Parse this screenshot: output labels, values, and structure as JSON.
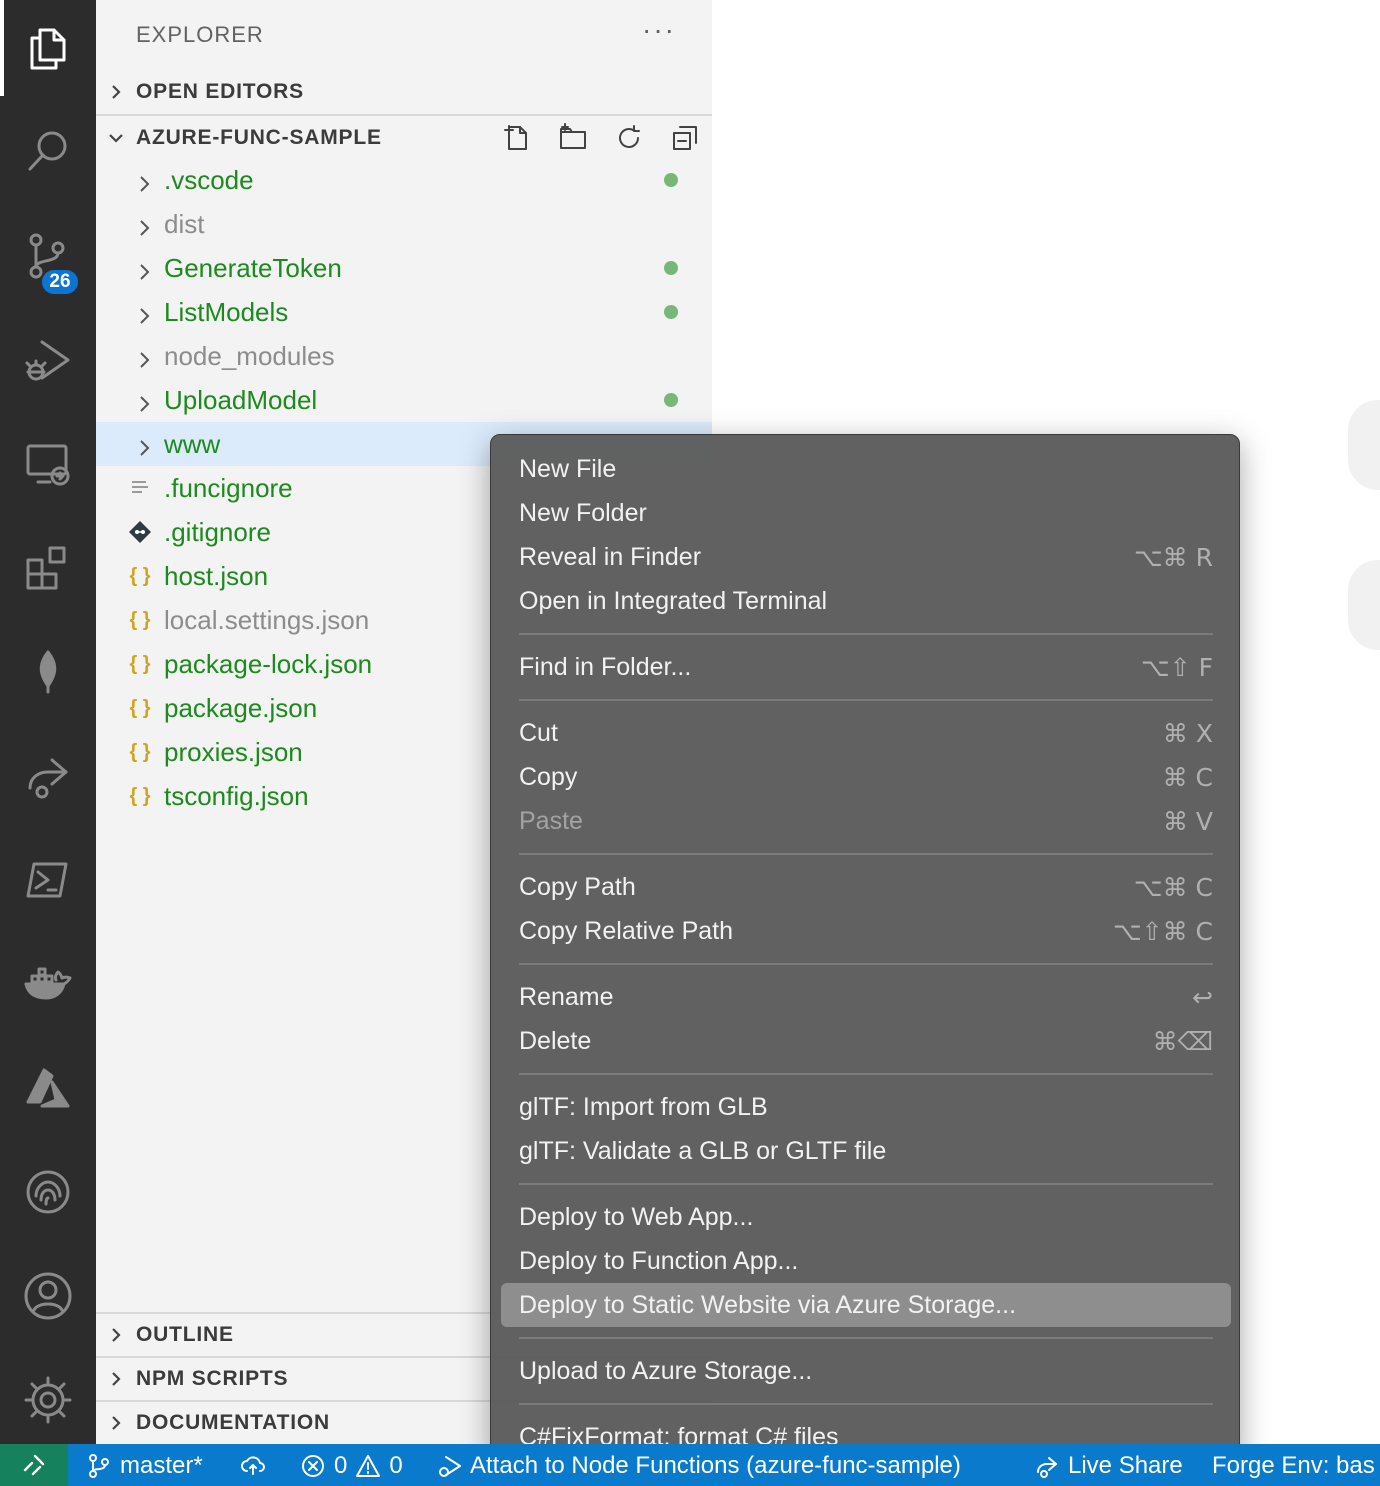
{
  "sidebar": {
    "title": "EXPLORER",
    "more": "···",
    "sections": {
      "open_editors": "OPEN EDITORS",
      "workspace": "AZURE-FUNC-SAMPLE",
      "outline": "OUTLINE",
      "npm_scripts": "NPM SCRIPTS",
      "documentation": "DOCUMENTATION"
    },
    "tree": [
      {
        "label": ".vscode",
        "type": "folder",
        "modified": true
      },
      {
        "label": "dist",
        "type": "folder",
        "modified": false
      },
      {
        "label": "GenerateToken",
        "type": "folder",
        "modified": true
      },
      {
        "label": "ListModels",
        "type": "folder",
        "modified": true
      },
      {
        "label": "node_modules",
        "type": "folder",
        "modified": false
      },
      {
        "label": "UploadModel",
        "type": "folder",
        "modified": true
      },
      {
        "label": "www",
        "type": "folder",
        "modified": false,
        "selected": true
      },
      {
        "label": ".funcignore",
        "type": "file-text"
      },
      {
        "label": ".gitignore",
        "type": "file-git"
      },
      {
        "label": "host.json",
        "type": "file-json"
      },
      {
        "label": "local.settings.json",
        "type": "file-json"
      },
      {
        "label": "package-lock.json",
        "type": "file-json"
      },
      {
        "label": "package.json",
        "type": "file-json"
      },
      {
        "label": "proxies.json",
        "type": "file-json"
      },
      {
        "label": "tsconfig.json",
        "type": "file-json"
      }
    ]
  },
  "activity_bar": {
    "source_control_badge": "26",
    "items": [
      "files-icon",
      "search-icon",
      "source-control-icon",
      "run-debug-icon",
      "remote-explorer-icon",
      "extensions-icon",
      "mongodb-icon",
      "live-share-icon",
      "powershell-icon",
      "docker-icon",
      "azure-icon",
      "fingerprint-icon",
      "account-icon",
      "settings-gear-icon"
    ]
  },
  "context_menu": {
    "items": [
      {
        "label": "New File",
        "shortcut": ""
      },
      {
        "label": "New Folder",
        "shortcut": ""
      },
      {
        "label": "Reveal in Finder",
        "shortcut": "⌥⌘ R"
      },
      {
        "label": "Open in Integrated Terminal",
        "shortcut": ""
      },
      {
        "sep": true
      },
      {
        "label": "Find in Folder...",
        "shortcut": "⌥⇧ F"
      },
      {
        "sep": true
      },
      {
        "label": "Cut",
        "shortcut": "⌘ X"
      },
      {
        "label": "Copy",
        "shortcut": "⌘ C"
      },
      {
        "label": "Paste",
        "shortcut": "⌘ V",
        "disabled": true
      },
      {
        "sep": true
      },
      {
        "label": "Copy Path",
        "shortcut": "⌥⌘ C"
      },
      {
        "label": "Copy Relative Path",
        "shortcut": "⌥⇧⌘ C"
      },
      {
        "sep": true
      },
      {
        "label": "Rename",
        "shortcut": "↩"
      },
      {
        "label": "Delete",
        "shortcut": "⌘⌫"
      },
      {
        "sep": true
      },
      {
        "label": "glTF: Import from GLB",
        "shortcut": ""
      },
      {
        "label": "glTF: Validate a GLB or GLTF file",
        "shortcut": ""
      },
      {
        "sep": true
      },
      {
        "label": "Deploy to Web App...",
        "shortcut": ""
      },
      {
        "label": "Deploy to Function App...",
        "shortcut": ""
      },
      {
        "label": "Deploy to Static Website via Azure Storage...",
        "shortcut": "",
        "highlighted": true
      },
      {
        "sep": true
      },
      {
        "label": "Upload to Azure Storage...",
        "shortcut": ""
      },
      {
        "sep": true
      },
      {
        "label": "C#FixFormat: format C# files",
        "shortcut": ""
      }
    ]
  },
  "status_bar": {
    "branch": "master*",
    "errors": "0",
    "warnings": "0",
    "attach": "Attach to Node Functions (azure-func-sample)",
    "live_share": "Live Share",
    "forge_env": "Forge Env: bas"
  },
  "colors": {
    "activity_bar": "#2c2c2c",
    "sidebar": "#f3f3f3",
    "status_bar": "#0a7acc",
    "remote_indicator": "#16825d",
    "modified_text": "#1d8a1d",
    "modified_dot": "#76b877",
    "selection": "#dcebfc",
    "menu_bg": "#5c5c5c",
    "menu_highlight": "#8e8e8e"
  }
}
